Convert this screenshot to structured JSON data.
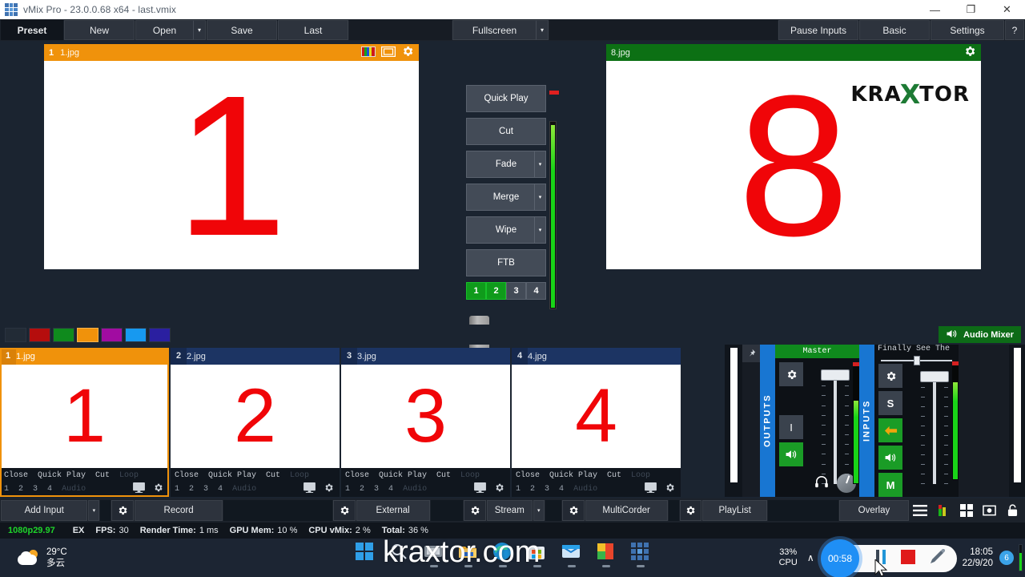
{
  "window": {
    "title": "vMix Pro - 23.0.0.68 x64 - last.vmix",
    "minimize": "—",
    "maximize": "❐",
    "close": "✕"
  },
  "menubar": {
    "preset": "Preset",
    "new": "New",
    "open": "Open",
    "open_arrow": "▾",
    "save": "Save",
    "last": "Last",
    "fullscreen": "Fullscreen",
    "fullscreen_arrow": "▾",
    "pause_inputs": "Pause Inputs",
    "basic": "Basic",
    "settings": "Settings",
    "help": "?"
  },
  "preview": {
    "number": "1",
    "name": "1.jpg",
    "content": "1"
  },
  "program": {
    "number": "8",
    "name": "8.jpg",
    "content": "8",
    "logo_left": "KRA",
    "logo_x": "X",
    "logo_right": "TOR"
  },
  "transitions": {
    "quick_play": "Quick Play",
    "cut": "Cut",
    "fade": "Fade",
    "merge": "Merge",
    "wipe": "Wipe",
    "ftb": "FTB",
    "arrow": "▾",
    "numbers": [
      {
        "label": "1",
        "active": true
      },
      {
        "label": "2",
        "active": true
      },
      {
        "label": "3",
        "active": false
      },
      {
        "label": "4",
        "active": false
      }
    ]
  },
  "swatches": [
    "#222b36",
    "#b50d0d",
    "#0f8a1d",
    "#f0920b",
    "#a10ca1",
    "#1799f0",
    "#2a1fa0"
  ],
  "audio_mixer_tab": {
    "label": "Audio Mixer",
    "icon": "speaker-icon"
  },
  "inputs": [
    {
      "number": "1",
      "name": "1.jpg",
      "content": "1",
      "selected": true,
      "close": "Close",
      "quick_play": "Quick Play",
      "cut": "Cut",
      "loop": "Loop",
      "buses": [
        "1",
        "2",
        "3",
        "4"
      ],
      "audio": "Audio"
    },
    {
      "number": "2",
      "name": "2.jpg",
      "content": "2",
      "selected": false,
      "close": "Close",
      "quick_play": "Quick Play",
      "cut": "Cut",
      "loop": "Loop",
      "buses": [
        "1",
        "2",
        "3",
        "4"
      ],
      "audio": "Audio"
    },
    {
      "number": "3",
      "name": "3.jpg",
      "content": "3",
      "selected": false,
      "close": "Close",
      "quick_play": "Quick Play",
      "cut": "Cut",
      "loop": "Loop",
      "buses": [
        "1",
        "2",
        "3",
        "4"
      ],
      "audio": "Audio"
    },
    {
      "number": "4",
      "name": "4.jpg",
      "content": "4",
      "selected": false,
      "close": "Close",
      "quick_play": "Quick Play",
      "cut": "Cut",
      "loop": "Loop",
      "buses": [
        "1",
        "2",
        "3",
        "4"
      ],
      "audio": "Audio"
    }
  ],
  "mixer": {
    "outputs_label": "OUTPUTS",
    "inputs_label": "INPUTS",
    "master": {
      "title": "Master",
      "gear": "⚙",
      "meter_btn": "I",
      "speaker": "speaker-icon"
    },
    "channel": {
      "title": "Finally See The",
      "gear": "⚙",
      "solo": "S",
      "bus": "←",
      "speaker": "speaker-icon",
      "mute": "M"
    },
    "headphone": "headphone-icon"
  },
  "bottombar": {
    "add_input": "Add Input",
    "add_input_arrow": "▾",
    "record": "Record",
    "external": "External",
    "stream": "Stream",
    "stream_arrow": "▾",
    "multicorder": "MultiCorder",
    "playlist": "PlayList",
    "overlay": "Overlay",
    "gear": "⚙",
    "icons": [
      "list-icon",
      "levels-icon",
      "grid-icon",
      "snapshot-icon",
      "lock-icon"
    ]
  },
  "statusbar": {
    "resolution": "1080p29.97",
    "ex": "EX",
    "fps_label": "FPS:",
    "fps_value": "30",
    "render_label": "Render Time:",
    "render_value": "1 ms",
    "gpu_label": "GPU Mem:",
    "gpu_value": "10 %",
    "cpu_label": "CPU vMix:",
    "cpu_value": "2 %",
    "total_label": "Total:",
    "total_value": "36 %"
  },
  "taskbar": {
    "weather_temp": "29°C",
    "weather_desc": "多云",
    "cpu_percent": "33%",
    "cpu_label": "CPU",
    "chevron": "∧",
    "rec_time": "00:58",
    "pause_icon": "pause-icon",
    "stop_icon": "stop-icon",
    "pen_icon": "pen-icon",
    "clock_time": "18:05",
    "clock_date": "22/9/20",
    "notification_count": "6",
    "watermark": "kraxtor.com",
    "apps": [
      "start-icon",
      "search-icon",
      "taskview-icon",
      "explorer-icon",
      "edge-icon",
      "store-icon",
      "mail-icon",
      "photos-icon",
      "vmix-icon"
    ]
  }
}
